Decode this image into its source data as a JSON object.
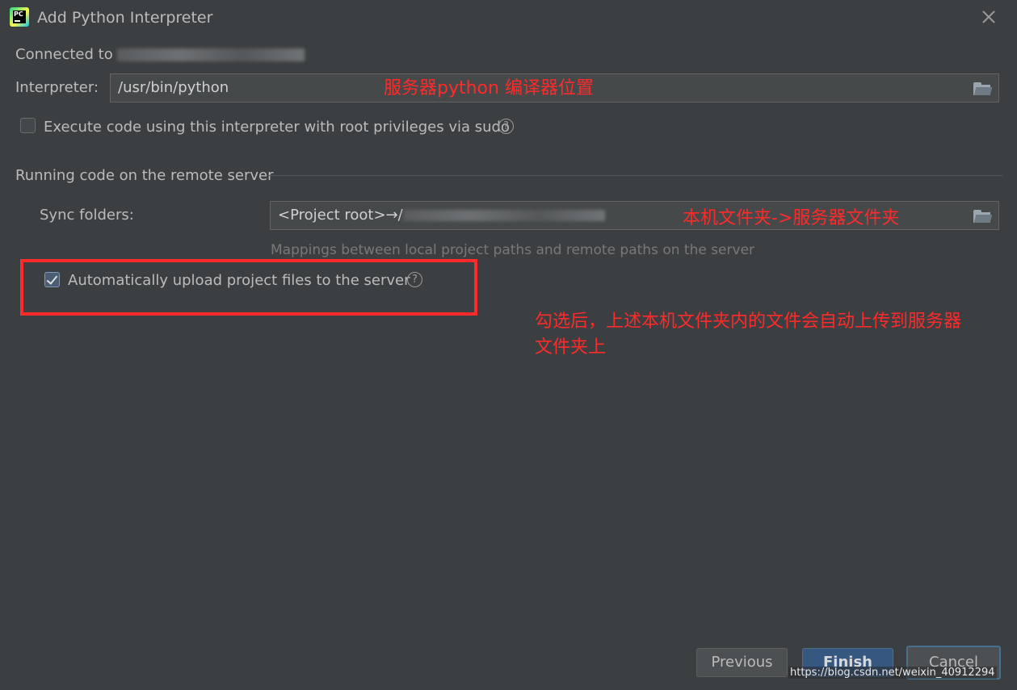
{
  "window": {
    "title": "Add Python Interpreter",
    "logo_text": "PC"
  },
  "connection": {
    "prefix": "Connected to "
  },
  "interpreter": {
    "label": "Interpreter:",
    "value": "/usr/bin/python",
    "annotation": "服务器python 编译器位置"
  },
  "sudo_option": {
    "label": "Execute code using this interpreter with root privileges via sudo",
    "checked": false
  },
  "remote_section": {
    "title": "Running code on the remote server",
    "sync_label": "Sync folders:",
    "sync_value_prefix": "<Project root>→/",
    "sync_annotation": "本机文件夹->服务器文件夹",
    "hint": "Mappings between local project paths and remote paths on the server"
  },
  "auto_upload": {
    "label": "Automatically upload project files to the server",
    "checked": true,
    "annotation_line1": "勾选后，上述本机文件夹内的文件会自动上传到服务器",
    "annotation_line2": "文件夹上"
  },
  "buttons": {
    "previous": "Previous",
    "finish": "Finish",
    "cancel": "Cancel"
  },
  "watermark": "https://blog.csdn.net/weixin_40912294",
  "colors": {
    "background": "#3c3f41",
    "annotation_red": "#ff2a2a",
    "primary_button": "#365880"
  },
  "icons": [
    "pycharm-logo-icon",
    "close-icon",
    "folder-icon",
    "help-icon",
    "checkbox-icon"
  ]
}
